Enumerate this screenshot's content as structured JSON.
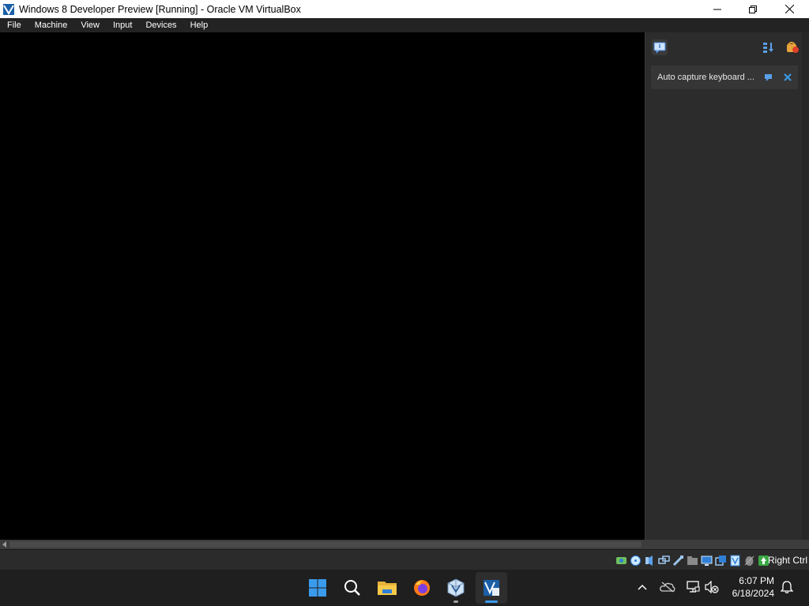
{
  "window": {
    "title": "Windows 8 Developer Preview [Running] - Oracle VM VirtualBox",
    "icon": "virtualbox-icon",
    "controls": [
      "minimize-icon",
      "restore-icon",
      "close-icon"
    ]
  },
  "menu": {
    "items": [
      {
        "label": "File"
      },
      {
        "label": "Machine"
      },
      {
        "label": "View"
      },
      {
        "label": "Input"
      },
      {
        "label": "Devices"
      },
      {
        "label": "Help"
      }
    ]
  },
  "notification_center": {
    "toolbar_icons": [
      "notification-center-icon",
      "sort-icon",
      "keep-finished-icon"
    ],
    "notifications": [
      {
        "message": "Auto capture keyboard ...",
        "icons": [
          "collapse-notification-icon",
          "close-notification-icon"
        ]
      }
    ]
  },
  "statusbar": {
    "indicator_icons": [
      "hard-disk-icon",
      "optical-drive-icon",
      "audio-icon",
      "network-icon",
      "usb-icon",
      "shared-folders-icon",
      "display-icon",
      "recording-icon",
      "virtualization-icon",
      "mouse-integration-icon",
      "keyboard-capture-icon"
    ],
    "host_key": "Right Ctrl"
  },
  "taskbar": {
    "apps": [
      "start-icon",
      "search-icon",
      "file-explorer-icon",
      "firefox-icon",
      "virtualbox-manager-icon",
      "virtualbox-vm-icon"
    ],
    "tray_icons": [
      "show-hidden-icons-chevron",
      "onedrive-icon",
      "network-icon",
      "volume-muted-icon",
      "notifications-bell-icon"
    ],
    "time": "6:07 PM",
    "date": "6/18/2024"
  },
  "colors": {
    "accent": "#0078d4",
    "menubar": "#232323",
    "panel": "#2c2c2c",
    "taskbar": "#1f1f1f"
  }
}
